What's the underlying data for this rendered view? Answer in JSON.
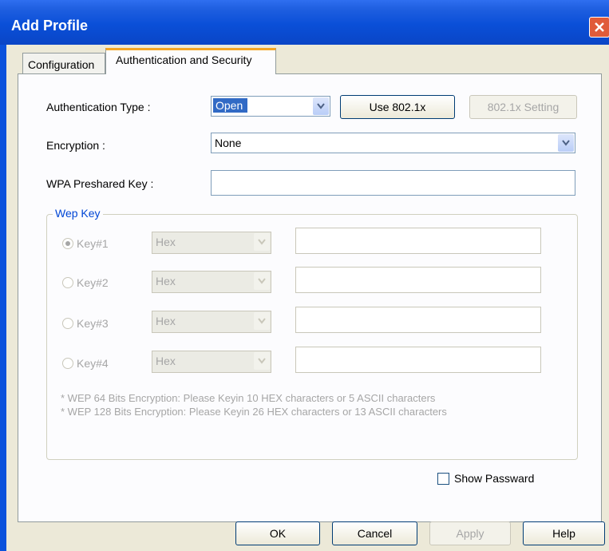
{
  "window": {
    "title": "Add Profile"
  },
  "tabs": [
    {
      "label": "Configuration"
    },
    {
      "label": "Authentication and Security"
    }
  ],
  "auth": {
    "type_label": "Authentication Type :",
    "type_value": "Open",
    "use_8021x_label": "Use 802.1x",
    "setting_8021x_label": "802.1x Setting"
  },
  "encryption": {
    "label": "Encryption :",
    "value": "None"
  },
  "wpa": {
    "label": "WPA Preshared Key :",
    "value": ""
  },
  "wep": {
    "group_title": "Wep Key",
    "keys": [
      {
        "label": "Key#1",
        "format": "Hex",
        "value": "",
        "selected": true
      },
      {
        "label": "Key#2",
        "format": "Hex",
        "value": "",
        "selected": false
      },
      {
        "label": "Key#3",
        "format": "Hex",
        "value": "",
        "selected": false
      },
      {
        "label": "Key#4",
        "format": "Hex",
        "value": "",
        "selected": false
      }
    ],
    "notes": [
      "* WEP 64 Bits Encryption:  Please Keyin 10 HEX characters or 5 ASCII characters",
      "* WEP 128 Bits Encryption:  Please Keyin 26 HEX characters or 13 ASCII characters"
    ]
  },
  "show_password": {
    "label": "Show Passward",
    "checked": false
  },
  "buttons": {
    "ok": "OK",
    "cancel": "Cancel",
    "apply": "Apply",
    "help": "Help"
  }
}
